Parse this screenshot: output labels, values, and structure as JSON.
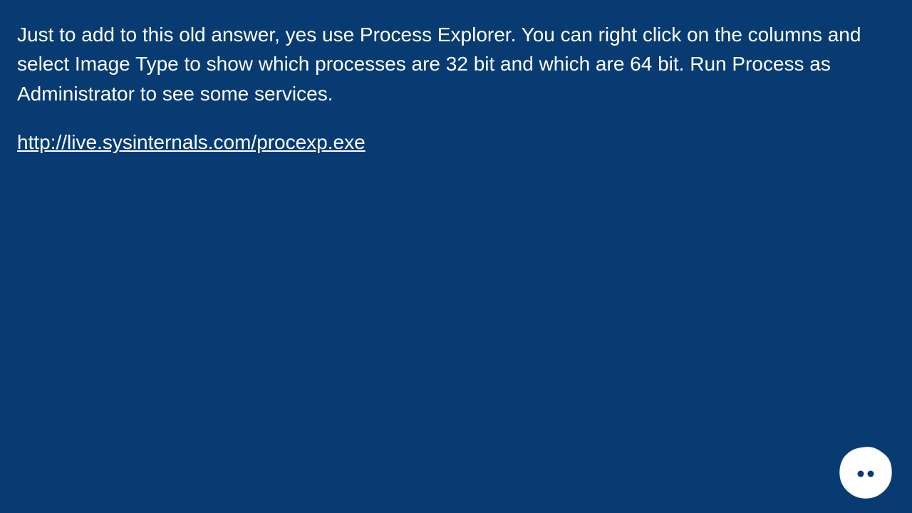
{
  "answer": {
    "body": "Just to add to this old answer, yes use Process Explorer. You can right click on the columns and select Image Type to show which processes are 32 bit and which are 64 bit. Run Process as Administrator to see some services.",
    "link_text": "http://live.sysinternals.com/procexp.exe",
    "link_href": "http://live.sysinternals.com/procexp.exe"
  }
}
